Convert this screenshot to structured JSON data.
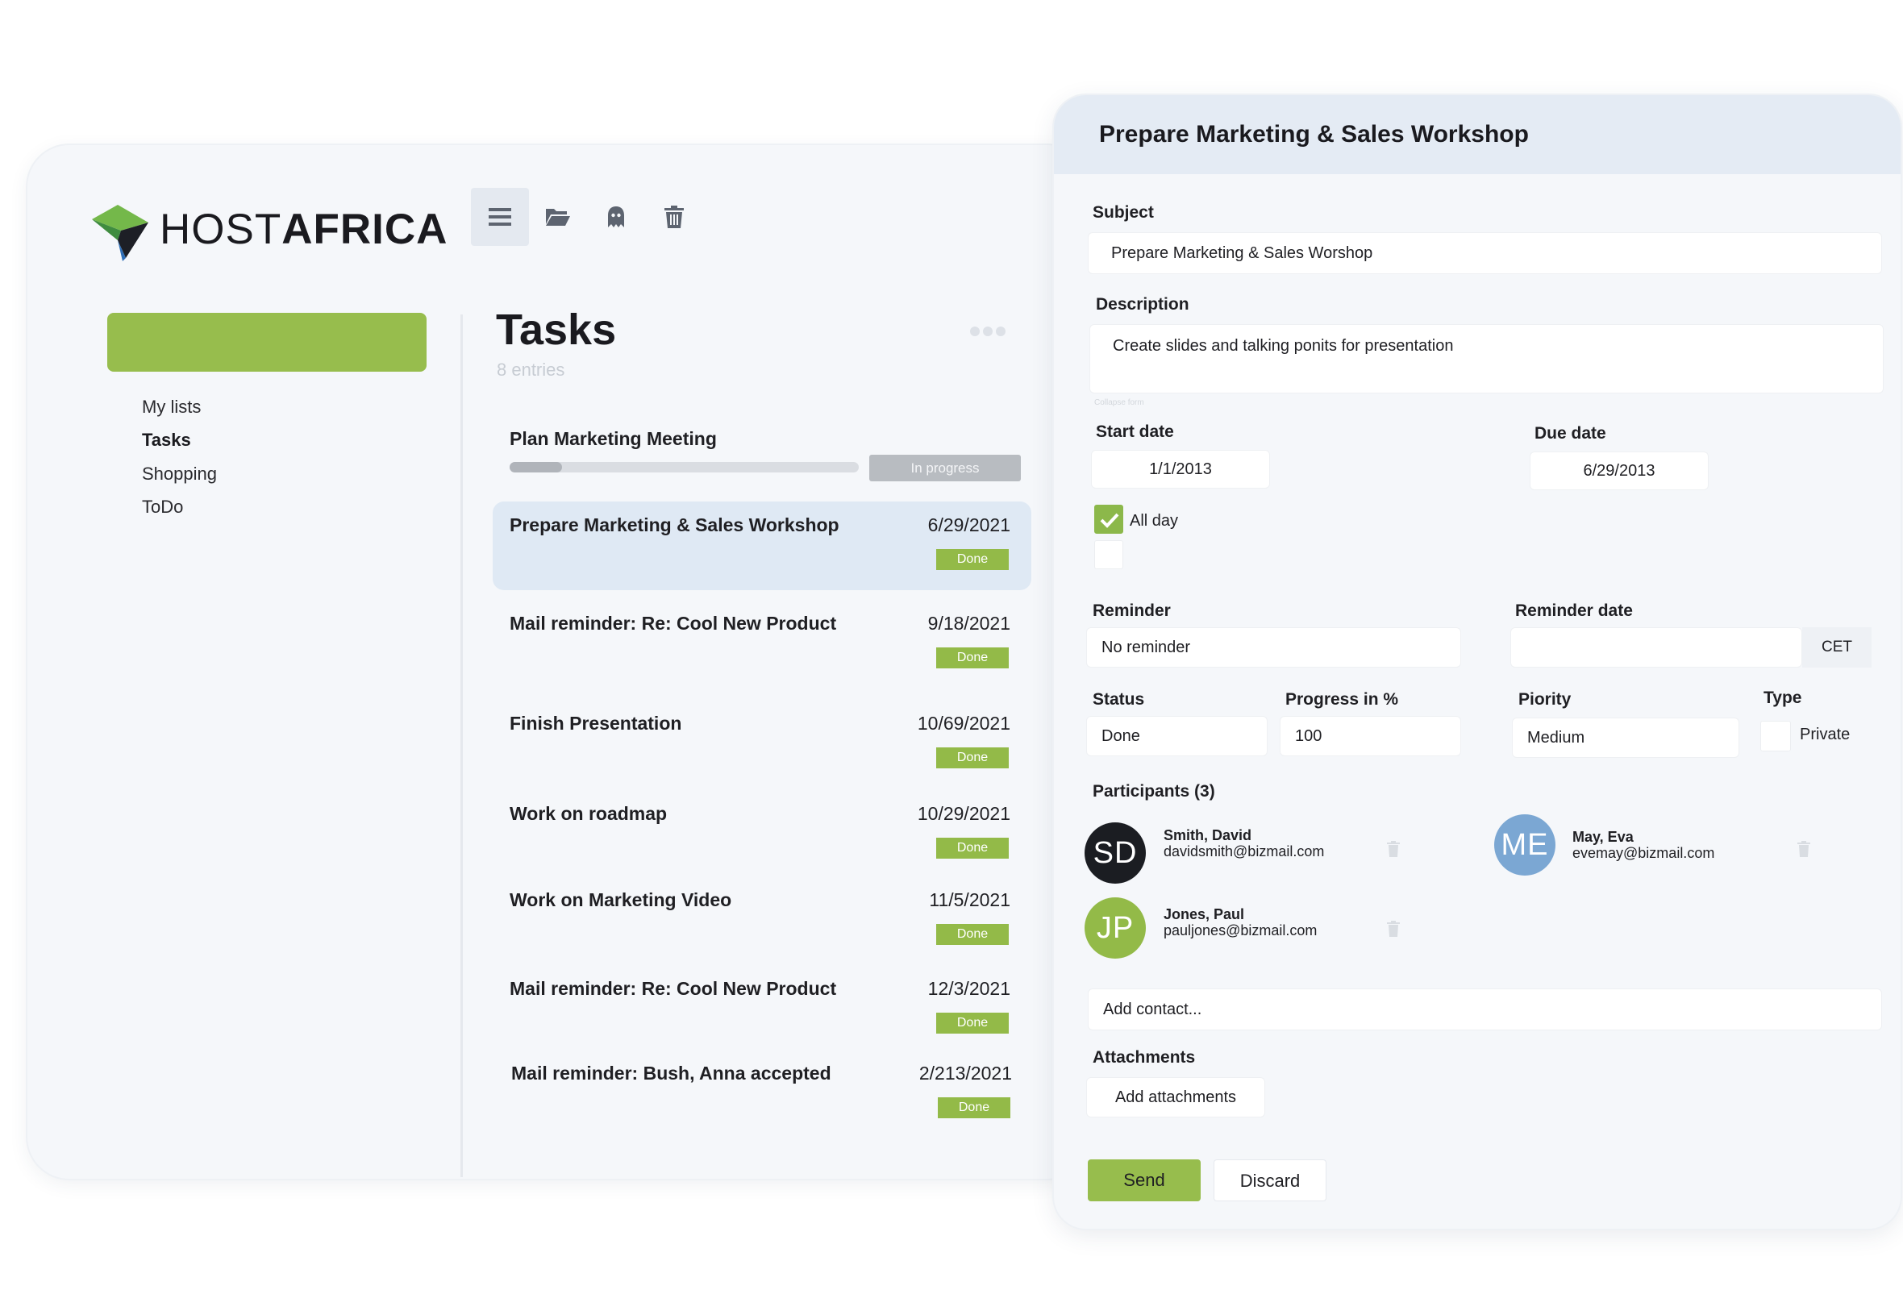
{
  "brand": {
    "name_light": "HOST",
    "name_bold": "AFRICA"
  },
  "toolbar": {
    "icons": [
      "list-icon",
      "folder-open-icon",
      "ghost-icon",
      "trash-icon"
    ]
  },
  "sidebar": {
    "new_button_label": "",
    "items": [
      {
        "label": "My lists"
      },
      {
        "label": "Tasks"
      },
      {
        "label": "Shopping"
      },
      {
        "label": "ToDo"
      }
    ]
  },
  "task_list": {
    "title": "Tasks",
    "count": "8 entries",
    "in_progress": {
      "title": "Plan Marketing Meeting",
      "status": "In progress",
      "progress": 0.15
    },
    "tasks": [
      {
        "title": "Prepare Marketing & Sales Workshop",
        "date": "6/29/2021",
        "status": "Done"
      },
      {
        "title": "Mail reminder: Re: Cool New Product",
        "date": "9/18/2021",
        "status": "Done"
      },
      {
        "title": "Finish Presentation",
        "date": "10/69/2021",
        "status": "Done"
      },
      {
        "title": "Work on roadmap",
        "date": "10/29/2021",
        "status": "Done"
      },
      {
        "title": "Work on Marketing Video",
        "date": "11/5/2021",
        "status": "Done"
      },
      {
        "title": "Mail reminder: Re: Cool New Product",
        "date": "12/3/2021",
        "status": "Done"
      },
      {
        "title": "Mail reminder: Bush, Anna accepted",
        "date": "2/213/2021",
        "status": "Done"
      }
    ]
  },
  "detail": {
    "title": "Prepare Marketing & Sales Workshop",
    "subject_label": "Subject",
    "subject_value": "Prepare Marketing & Sales Worshop",
    "description_label": "Description",
    "description_value": "Create slides and talking ponits for presentation",
    "collapse_text": "Collapse form",
    "start_date_label": "Start date",
    "start_date_value": "1/1/2013",
    "due_date_label": "Due date",
    "due_date_value": "6/29/2013",
    "all_day_label": "All day",
    "all_day_checked": true,
    "reminder_label": "Reminder",
    "reminder_value": "No reminder",
    "reminder_date_label": "Reminder date",
    "reminder_date_value": "",
    "timezone": "CET",
    "status_label": "Status",
    "status_value": "Done",
    "progress_label": "Progress in %",
    "progress_value": "100",
    "priority_label": "Piority",
    "priority_value": "Medium",
    "type_label": "Type",
    "type_value": "Private",
    "participants_label": "Participants (3)",
    "participants": [
      {
        "initials": "SD",
        "name": "Smith, David",
        "email": "davidsmith@bizmail.com",
        "color": "#1b1d22"
      },
      {
        "initials": "ME",
        "name": "May, Eva",
        "email": "evemay@bizmail.com",
        "color": "#7ba7d3"
      },
      {
        "initials": "JP",
        "name": "Jones, Paul",
        "email": "pauljones@bizmail.com",
        "color": "#93ba48"
      }
    ],
    "add_contact_placeholder": "Add contact...",
    "attachments_label": "Attachments",
    "add_attachments_label": "Add attachments",
    "send_label": "Send",
    "discard_label": "Discard"
  },
  "colors": {
    "accent_green": "#97bd4d",
    "selected_row": "#dfe9f4",
    "header_bg": "#e4ebf4"
  }
}
